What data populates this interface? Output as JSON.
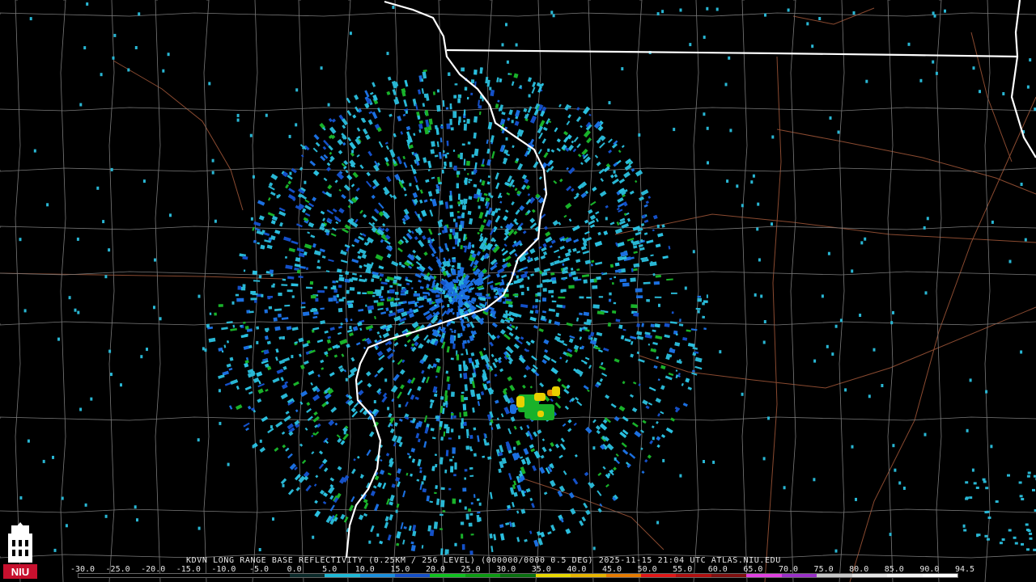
{
  "caption": "KDVN LONG RANGE BASE REFLECTIVITY (0.25KM / 256 LEVEL) (000000/0000 0.5 DEG) 2025-11-15 21:04 UTC  ATLAS.NIU.EDU",
  "logo_text": "NIU",
  "scale": {
    "ticks": [
      "-30.0",
      "-25.0",
      "-20.0",
      "-15.0",
      "-10.0",
      "-5.0",
      "0.0",
      "5.0",
      "10.0",
      "15.0",
      "20.0",
      "25.0",
      "30.0",
      "35.0",
      "40.0",
      "45.0",
      "50.0",
      "55.0",
      "60.0",
      "65.0",
      "70.0",
      "75.0",
      "80.0",
      "85.0",
      "90.0",
      "94.5"
    ],
    "colors": [
      "#000000",
      "#000000",
      "#000000",
      "#000000",
      "#000000",
      "#000000",
      "#0b2a2a",
      "#1fb9d6",
      "#1a8fdc",
      "#1450c8",
      "#10c020",
      "#0c9a12",
      "#0a7010",
      "#e8d800",
      "#e6b400",
      "#e67a00",
      "#e01818",
      "#b01010",
      "#801010",
      "#e040e0",
      "#9a30c8",
      "#c8c8c8",
      "#e6e6e6",
      "#f4f4f4",
      "#ffffff"
    ]
  },
  "map": {
    "radar_name": "KDVN",
    "colors": {
      "background": "#000000",
      "county_lines": "#7a7a7a",
      "state_lines": "#ffffff",
      "highways": "#8a4a30",
      "echo_light": "#29b7d4",
      "echo_medium": "#1b6fe0",
      "echo_green": "#19b22a",
      "echo_yellow": "#e8d000",
      "echo_orange": "#e88a00"
    }
  }
}
